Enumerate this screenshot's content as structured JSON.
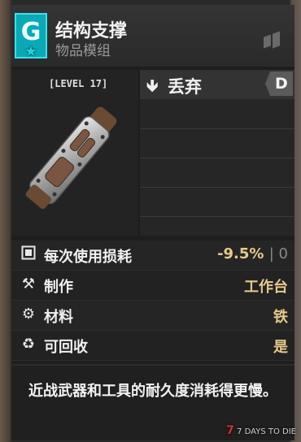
{
  "item": {
    "tier": "G",
    "name": "结构支撑",
    "group": "物品模组",
    "level": "[LEVEL 17]"
  },
  "actions": {
    "drop_label": "丢弃",
    "drop_key": "D"
  },
  "stats": [
    {
      "label": "每次使用损耗",
      "value": "-9.5%",
      "extra": "| 0",
      "icon": "square-icon"
    },
    {
      "label": "制作",
      "value": "工作台",
      "icon": "tools-icon"
    },
    {
      "label": "材料",
      "value": "铁",
      "icon": "materials-icon"
    },
    {
      "label": "可回收",
      "value": "是",
      "icon": "recycle-icon"
    }
  ],
  "description": "近战武器和工具的耐久度消耗得更慢。",
  "watermark": "7 DAYS TO DIE",
  "colors": {
    "tier_badge": "#0aa9b5",
    "stat_value": "#e6c98c",
    "panel_bg": "#1e1e1e"
  }
}
